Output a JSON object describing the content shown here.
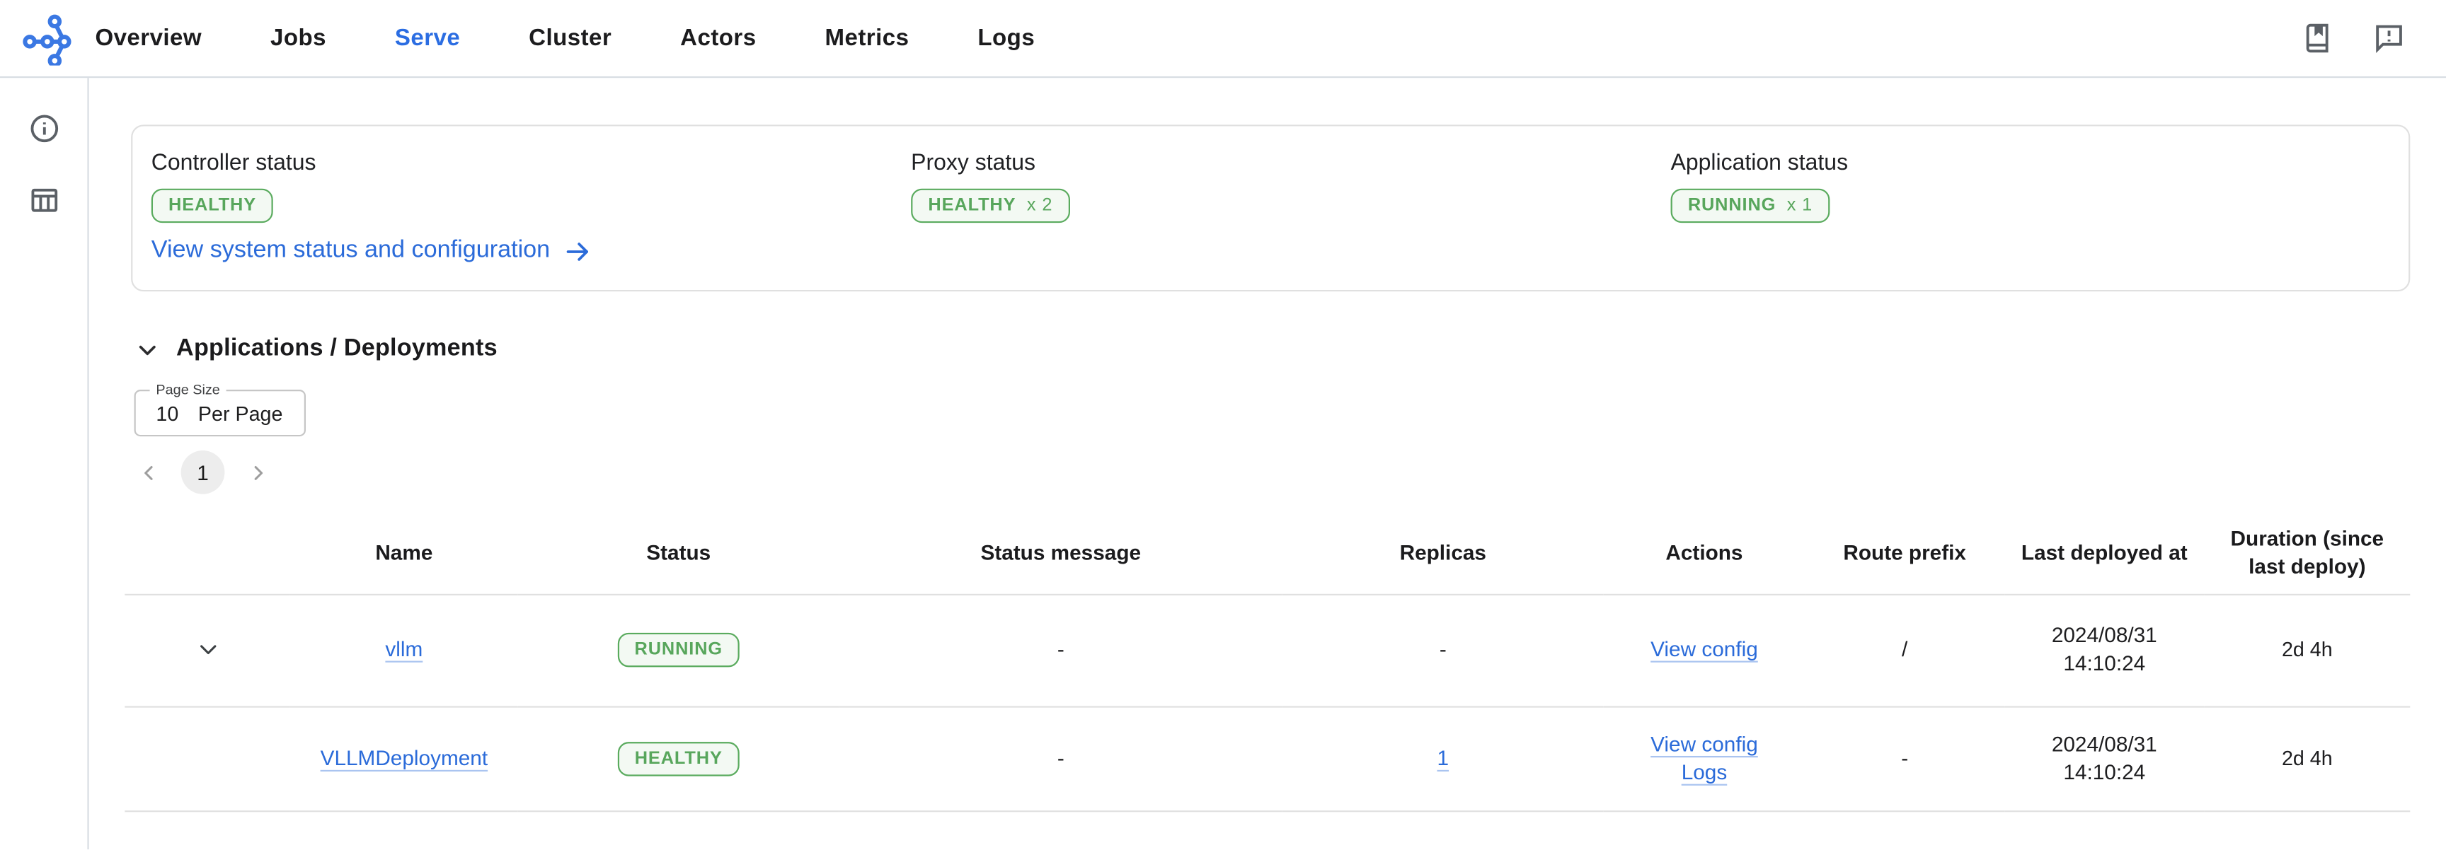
{
  "nav": {
    "items": [
      {
        "label": "Overview"
      },
      {
        "label": "Jobs"
      },
      {
        "label": "Serve"
      },
      {
        "label": "Cluster"
      },
      {
        "label": "Actors"
      },
      {
        "label": "Metrics"
      },
      {
        "label": "Logs"
      }
    ],
    "active": "Serve"
  },
  "status_card": {
    "controller": {
      "label": "Controller status",
      "status": "HEALTHY",
      "count": ""
    },
    "proxy": {
      "label": "Proxy status",
      "status": "HEALTHY",
      "count": "x 2"
    },
    "application": {
      "label": "Application status",
      "status": "RUNNING",
      "count": "x 1"
    },
    "link_label": "View system status and configuration"
  },
  "section": {
    "title": "Applications / Deployments"
  },
  "page_size": {
    "label": "Page Size",
    "value": "10",
    "suffix": "Per Page"
  },
  "pagination": {
    "current": "1"
  },
  "table": {
    "columns": [
      "",
      "Name",
      "Status",
      "Status message",
      "Replicas",
      "Actions",
      "Route prefix",
      "Last deployed at",
      "Duration (since last deploy)"
    ],
    "rows": [
      {
        "name": "vllm",
        "status": "RUNNING",
        "status_message": "-",
        "replicas": "-",
        "action1": "View config",
        "action2": "",
        "route_prefix": "/",
        "deployed_date": "2024/08/31",
        "deployed_time": "14:10:24",
        "duration": "2d 4h"
      },
      {
        "name": "VLLMDeployment",
        "status": "HEALTHY",
        "status_message": "-",
        "replicas": "1",
        "action1": "View config",
        "action2": "Logs",
        "route_prefix": "-",
        "deployed_date": "2024/08/31",
        "deployed_time": "14:10:24",
        "duration": "2d 4h"
      }
    ]
  },
  "colors": {
    "accent_blue": "#2b6bd9",
    "nav_active_blue": "#2b6de2",
    "status_green_text": "#58a65c",
    "status_green_border": "#5aab5e",
    "status_green_bg": "#f3f9f3",
    "divider": "#d8dde3"
  }
}
